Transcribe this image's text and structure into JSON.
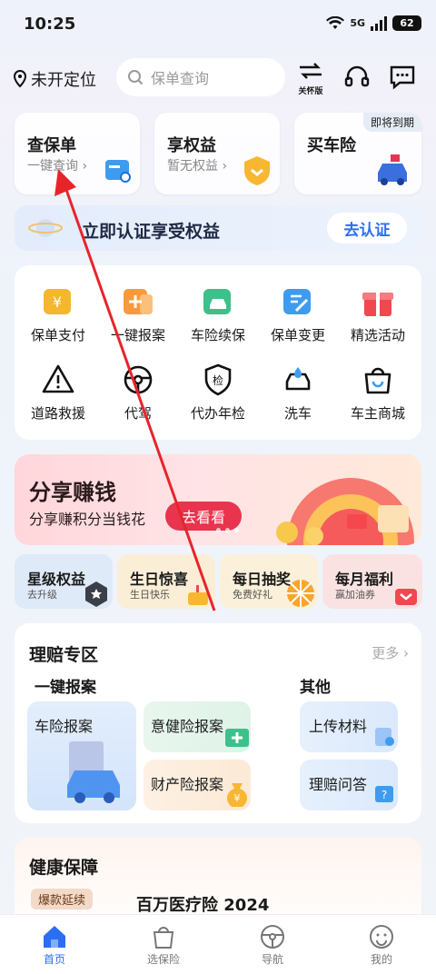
{
  "status": {
    "time": "10:25",
    "network": "5G",
    "battery": "62"
  },
  "topbar": {
    "location": "未开定位",
    "search_placeholder": "保单查询",
    "care_label": "关怀版"
  },
  "cards": [
    {
      "title": "查保单",
      "subtitle": "一键查询 ›"
    },
    {
      "title": "享权益",
      "subtitle": "暂无权益 ›"
    },
    {
      "title": "买车险",
      "badge": "即将到期"
    }
  ],
  "auth": {
    "text": "立即认证享受权益",
    "button": "去认证"
  },
  "services": [
    {
      "label": "保单支付",
      "icon": "yuan-wallet-icon"
    },
    {
      "label": "一键报案",
      "icon": "plus-folder-icon"
    },
    {
      "label": "车险续保",
      "icon": "car-icon"
    },
    {
      "label": "保单变更",
      "icon": "edit-doc-icon"
    },
    {
      "label": "精选活动",
      "icon": "gift-icon"
    },
    {
      "label": "道路救援",
      "icon": "warning-triangle-icon"
    },
    {
      "label": "代驾",
      "icon": "steering-wheel-icon"
    },
    {
      "label": "代办年检",
      "icon": "inspection-shield-icon"
    },
    {
      "label": "洗车",
      "icon": "car-wash-icon"
    },
    {
      "label": "车主商城",
      "icon": "shopping-bag-icon"
    }
  ],
  "banner": {
    "title": "分享赚钱",
    "subtitle": "分享赚积分当钱花",
    "button": "去看看"
  },
  "chips": [
    {
      "title": "星级权益",
      "subtitle": "去升级",
      "color": "#dfeaf8"
    },
    {
      "title": "生日惊喜",
      "subtitle": "生日快乐",
      "color": "#fbeed6"
    },
    {
      "title": "每日抽奖",
      "subtitle": "免费好礼",
      "color": "#fbf0d9"
    },
    {
      "title": "每月福利",
      "subtitle": "赢加油券",
      "color": "#fbe2e2"
    }
  ],
  "claims": {
    "title": "理赔专区",
    "more": "更多 ›",
    "left_title": "一键报案",
    "right_title": "其他",
    "items": [
      "车险报案",
      "意健险报案",
      "财产险报案",
      "上传材料",
      "理赔问答"
    ]
  },
  "health": {
    "title": "健康保障",
    "tag": "爆款延续",
    "product": "百万医疗险 2024"
  },
  "tabs": [
    {
      "label": "首页",
      "active": true
    },
    {
      "label": "选保险",
      "active": false
    },
    {
      "label": "导航",
      "active": false
    },
    {
      "label": "我的",
      "active": false
    }
  ],
  "accent": "#2b6ef5",
  "annotation_color": "#e8242b"
}
